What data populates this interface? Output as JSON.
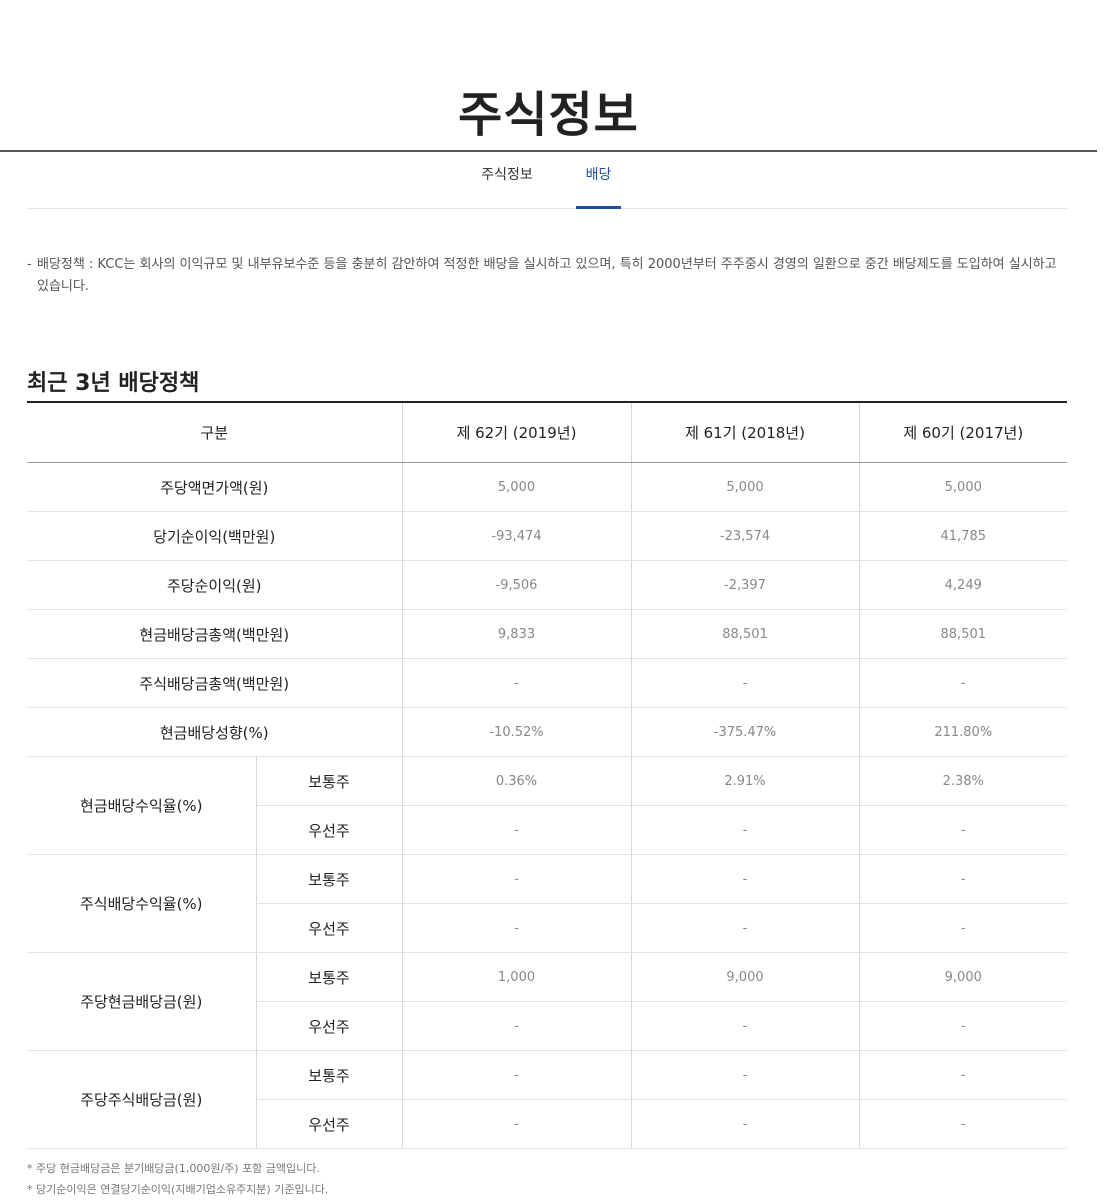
{
  "page": {
    "title": "주식정보"
  },
  "tabs": [
    {
      "label": "주식정보",
      "active": false
    },
    {
      "label": "배당",
      "active": true
    }
  ],
  "colors": {
    "accent": "#1f4e9c",
    "text": "#333333",
    "muted": "#888888"
  },
  "policy": {
    "dash": "-",
    "text": "배당정책 : KCC는 회사의 이익규모 및 내부유보수준 등을 충분히 감안하여 적정한 배당을 실시하고 있으며, 특히 2000년부터 주주중시 경영의 일환으로 중간 배당제도를 도입하여 실시하고 있습니다."
  },
  "section": {
    "title": "최근 3년 배당정책"
  },
  "table": {
    "headers": [
      "구분",
      "제 62기 (2019년)",
      "제 61기 (2018년)",
      "제 60기 (2017년)"
    ],
    "rows": [
      {
        "label": "주당액면가액(원)",
        "values": [
          "5,000",
          "5,000",
          "5,000"
        ]
      },
      {
        "label": "당기순이익(백만원)",
        "values": [
          "-93,474",
          "-23,574",
          "41,785"
        ]
      },
      {
        "label": "주당순이익(원)",
        "values": [
          "-9,506",
          "-2,397",
          "4,249"
        ]
      },
      {
        "label": "현금배당금총액(백만원)",
        "values": [
          "9,833",
          "88,501",
          "88,501"
        ]
      },
      {
        "label": "주식배당금총액(백만원)",
        "values": [
          "-",
          "-",
          "-"
        ]
      },
      {
        "label": "현금배당성향(%)",
        "values": [
          "-10.52%",
          "-375.47%",
          "211.80%"
        ]
      }
    ],
    "groups": [
      {
        "label": "현금배당수익율(%)",
        "rows": [
          {
            "label": "보통주",
            "values": [
              "0.36%",
              "2.91%",
              "2.38%"
            ]
          },
          {
            "label": "우선주",
            "values": [
              "-",
              "-",
              "-"
            ]
          }
        ]
      },
      {
        "label": "주식배당수익율(%)",
        "rows": [
          {
            "label": "보통주",
            "values": [
              "-",
              "-",
              "-"
            ]
          },
          {
            "label": "우선주",
            "values": [
              "-",
              "-",
              "-"
            ]
          }
        ]
      },
      {
        "label": "주당현금배당금(원)",
        "rows": [
          {
            "label": "보통주",
            "values": [
              "1,000",
              "9,000",
              "9,000"
            ]
          },
          {
            "label": "우선주",
            "values": [
              "-",
              "-",
              "-"
            ]
          }
        ]
      },
      {
        "label": "주당주식배당금(원)",
        "rows": [
          {
            "label": "보통주",
            "values": [
              "-",
              "-",
              "-"
            ]
          },
          {
            "label": "우선주",
            "values": [
              "-",
              "-",
              "-"
            ]
          }
        ]
      }
    ]
  },
  "notes": [
    "* 주당 현금배당금은 분기배당금(1,000원/주) 포함 금액입니다.",
    "* 당기순이익은 연결당기순이익(지배기업소유주지분) 기준입니다."
  ]
}
